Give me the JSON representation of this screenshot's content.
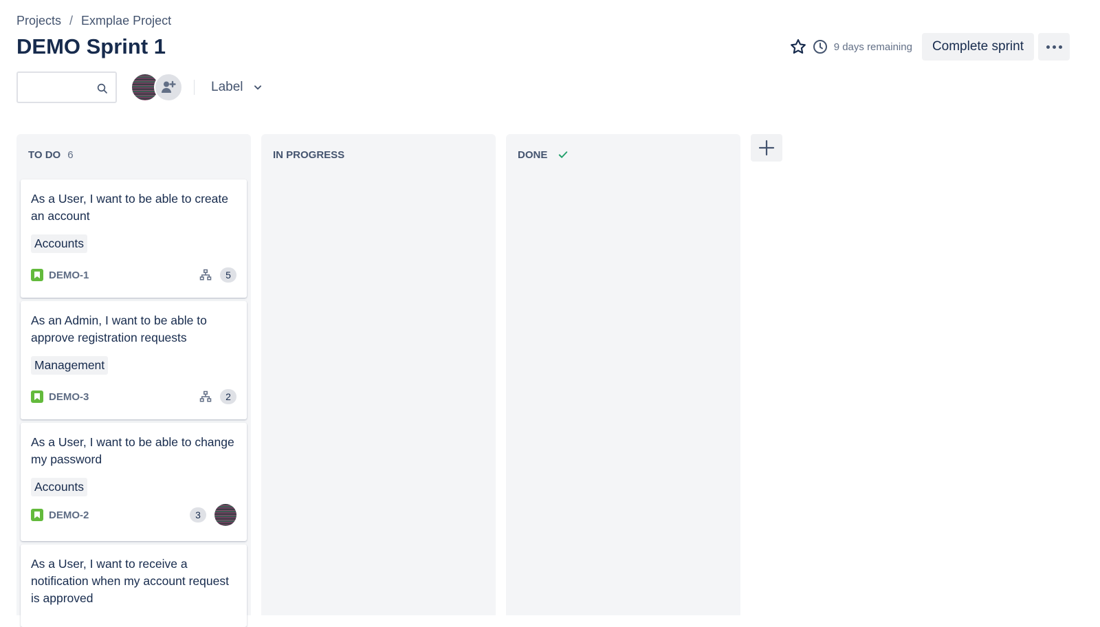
{
  "breadcrumb": {
    "items": [
      "Projects",
      "Exmplae Project"
    ],
    "separator": "/"
  },
  "page_title": "DEMO Sprint 1",
  "header_actions": {
    "time_remaining": "9 days remaining",
    "complete_label": "Complete sprint",
    "star_icon": "star-icon",
    "clock_icon": "clock-icon",
    "more_icon": "more-icon"
  },
  "filters": {
    "search_placeholder": "",
    "search_value": "",
    "label_filter": "Label"
  },
  "columns": [
    {
      "title": "TO DO",
      "count": "6",
      "cards": [
        {
          "title": "As a User, I want to be able to create an account",
          "label": "Accounts",
          "key": "DEMO-1",
          "subtasks": "5",
          "has_avatar": false
        },
        {
          "title": "As an Admin, I want to be able to approve registration requests",
          "label": "Management",
          "key": "DEMO-3",
          "subtasks": "2",
          "has_avatar": false
        },
        {
          "title": "As a User, I want to be able to change my password",
          "label": "Accounts",
          "key": "DEMO-2",
          "points": "3",
          "has_avatar": true
        },
        {
          "title": "As a User, I want to receive a notification when my account request is approved"
        }
      ]
    },
    {
      "title": "IN PROGRESS",
      "count": "",
      "cards": []
    },
    {
      "title": "DONE",
      "count": "",
      "cards": [],
      "done_check": true
    }
  ],
  "colors": {
    "story_green": "#63ba3c",
    "done_check": "#22a06b",
    "text_primary": "#172b4d",
    "column_bg": "#f4f5f7"
  }
}
